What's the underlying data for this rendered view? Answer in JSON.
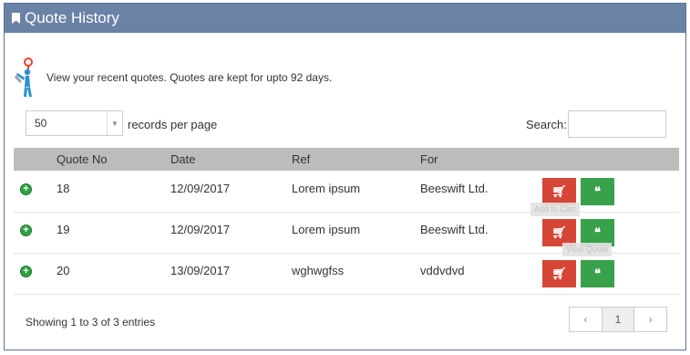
{
  "panel": {
    "title": "Quote History"
  },
  "intro": {
    "text": "View your recent quotes. Quotes are kept for upto 92 days."
  },
  "length": {
    "value": "50",
    "label": "records per page"
  },
  "search": {
    "label": "Search:",
    "value": ""
  },
  "table": {
    "headers": [
      "Quote No",
      "Date",
      "Ref",
      "For"
    ],
    "rows": [
      {
        "quote_no": "18",
        "date": "12/09/2017",
        "ref": "Lorem ipsum",
        "for": "Beeswift Ltd."
      },
      {
        "quote_no": "19",
        "date": "12/09/2017",
        "ref": "Lorem ipsum",
        "for": "Beeswift Ltd."
      },
      {
        "quote_no": "20",
        "date": "13/09/2017",
        "ref": "wghwgfss",
        "for": "vddvdvd"
      }
    ]
  },
  "tooltips": {
    "cart": "Add to Cart",
    "quote": "View Quote"
  },
  "footer": {
    "info": "Showing 1 to 3 of 3 entries"
  },
  "pagination": {
    "prev": "‹",
    "current": "1",
    "next": "›"
  },
  "colors": {
    "header": "#6a82a6",
    "cart_button": "#d64636",
    "quote_button": "#3aa14b",
    "table_head": "#bcbcbc"
  }
}
